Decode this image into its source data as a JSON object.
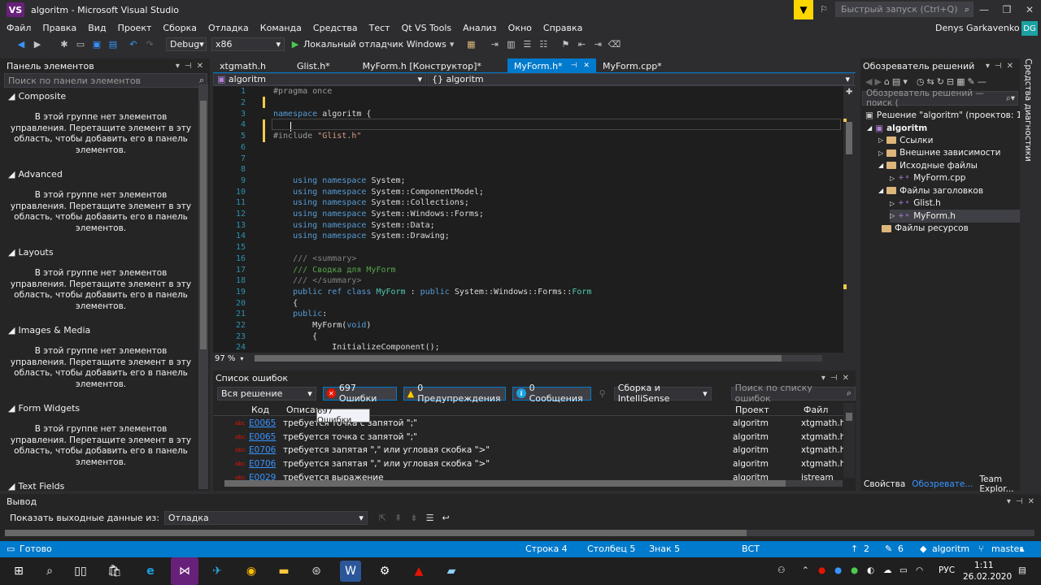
{
  "window": {
    "title": "algoritm - Microsoft Visual Studio",
    "quick_launch_placeholder": "Быстрый запуск (Ctrl+Q)"
  },
  "menu": [
    "Файл",
    "Правка",
    "Вид",
    "Проект",
    "Сборка",
    "Отладка",
    "Команда",
    "Средства",
    "Тест",
    "Qt VS Tools",
    "Анализ",
    "Окно",
    "Справка"
  ],
  "user": {
    "name": "Denys Garkavenko",
    "initials": "DG"
  },
  "toolbar": {
    "config": "Debug",
    "platform": "x86",
    "debugger": "Локальный отладчик Windows"
  },
  "toolbox": {
    "title": "Панель элементов",
    "search_placeholder": "Поиск по панели элементов",
    "empty_message": "В этой группе нет элементов управления. Перетащите элемент в эту область, чтобы добавить его в панель элементов.",
    "groups": [
      "Composite",
      "Advanced",
      "Layouts",
      "Images & Media",
      "Form Widgets",
      "Text Fields"
    ]
  },
  "editor": {
    "tabs": [
      "xtgmath.h",
      "Glist.h*",
      "MyForm.h [Конструктор]*",
      "MyForm.h*",
      "MyForm.cpp*"
    ],
    "active_tab": 3,
    "nav_left": "algoritm",
    "nav_right": "{} algoritm",
    "zoom": "97 %",
    "lines": [
      {
        "n": "1",
        "html": "<span class='pp'>#pragma once</span>"
      },
      {
        "n": "2",
        "html": ""
      },
      {
        "n": "3",
        "html": "<span class='kw'>namespace</span> <span class='pl'>algoritm {</span>"
      },
      {
        "n": "4",
        "html": ""
      },
      {
        "n": "5",
        "html": "<span class='pp'>#include</span> <span class='str'>\"Glist.h\"</span>"
      },
      {
        "n": "6",
        "html": ""
      },
      {
        "n": "7",
        "html": ""
      },
      {
        "n": "8",
        "html": ""
      },
      {
        "n": "9",
        "html": "    <span class='kw'>using namespace</span> <span class='pl'>System;</span>"
      },
      {
        "n": "10",
        "html": "    <span class='kw'>using namespace</span> <span class='pl'>System::ComponentModel;</span>"
      },
      {
        "n": "11",
        "html": "    <span class='kw'>using namespace</span> <span class='pl'>System::Collections;</span>"
      },
      {
        "n": "12",
        "html": "    <span class='kw'>using namespace</span> <span class='pl'>System::Windows::Forms;</span>"
      },
      {
        "n": "13",
        "html": "    <span class='kw'>using namespace</span> <span class='pl'>System::Data;</span>"
      },
      {
        "n": "14",
        "html": "    <span class='kw'>using namespace</span> <span class='pl'>System::Drawing;</span>"
      },
      {
        "n": "15",
        "html": ""
      },
      {
        "n": "16",
        "html": "    <span class='xml'>///</span> <span class='xml'>&lt;summary&gt;</span>"
      },
      {
        "n": "17",
        "html": "    <span class='cm'>/// Сводка для MyForm</span>"
      },
      {
        "n": "18",
        "html": "    <span class='xml'>///</span> <span class='xml'>&lt;/summary&gt;</span>"
      },
      {
        "n": "19",
        "html": "    <span class='kw'>public ref class</span> <span class='ty'>MyForm</span> <span class='pl'>:</span> <span class='kw'>public</span> <span class='pl'>System::Windows::Forms::</span><span class='ty'>Form</span>"
      },
      {
        "n": "20",
        "html": "    <span class='pl'>{</span>"
      },
      {
        "n": "21",
        "html": "    <span class='kw'>public</span><span class='pl'>:</span>"
      },
      {
        "n": "22",
        "html": "        <span class='pl'>MyForm(</span><span class='kw'>void</span><span class='pl'>)</span>"
      },
      {
        "n": "23",
        "html": "        <span class='pl'>{</span>"
      },
      {
        "n": "24",
        "html": "            <span class='pl'>InitializeComponent();</span>"
      }
    ]
  },
  "error_list": {
    "title": "Список ошибок",
    "scope": "Вся решение",
    "errors_label": "697 Ошибки",
    "warnings_label": "0 Предупреждения",
    "messages_label": "0 Сообщения",
    "build_filter": "Сборка и IntelliSense",
    "search_placeholder": "Поиск по списку ошибок",
    "tooltip": "697 Ошибки",
    "columns": [
      "Код",
      "Описан",
      "Проект",
      "Файл"
    ],
    "rows": [
      {
        "code": "E0065",
        "desc": "требуется точка с запятой \";\"",
        "project": "algoritm",
        "file": "xtgmath.h"
      },
      {
        "code": "E0065",
        "desc": "требуется точка с запятой \";\"",
        "project": "algoritm",
        "file": "xtgmath.h"
      },
      {
        "code": "E0706",
        "desc": "требуется запятая \",\" или угловая скобка \">\"",
        "project": "algoritm",
        "file": "xtgmath.h"
      },
      {
        "code": "E0706",
        "desc": "требуется запятая \",\" или угловая скобка \">\"",
        "project": "algoritm",
        "file": "xtgmath.h"
      },
      {
        "code": "E0029",
        "desc": "требуется выражение",
        "project": "algoritm",
        "file": "istream"
      }
    ]
  },
  "solution": {
    "title": "Обозреватель решений",
    "search_placeholder": "Обозреватель решений — поиск (",
    "root": "Решение \"algoritm\"  (проектов: 1)",
    "project": "algoritm",
    "items": [
      {
        "label": "Ссылки",
        "depth": 1
      },
      {
        "label": "Внешние зависимости",
        "depth": 1
      },
      {
        "label": "Исходные файлы",
        "depth": 1
      },
      {
        "label": "MyForm.cpp",
        "depth": 2
      },
      {
        "label": "Файлы заголовков",
        "depth": 1
      },
      {
        "label": "Glist.h",
        "depth": 2
      },
      {
        "label": "MyForm.h",
        "depth": 2
      },
      {
        "label": "Файлы ресурсов",
        "depth": 1
      }
    ],
    "bottom_tabs": [
      "Свойства",
      "Обозревате...",
      "Team Explor..."
    ],
    "diag_label": "Средства диагностики"
  },
  "output": {
    "title": "Вывод",
    "show_from_label": "Показать выходные данные из:",
    "source": "Отладка"
  },
  "status": {
    "ready": "Готово",
    "line": "Строка 4",
    "col": "Столбец 5",
    "char": "Знак 5",
    "mode": "ВСТ",
    "up_count": "2",
    "edit_count": "6",
    "repo": "algoritm",
    "branch": "master"
  },
  "taskbar": {
    "lang": "РУС",
    "time": "1:11",
    "date": "26.02.2020"
  }
}
